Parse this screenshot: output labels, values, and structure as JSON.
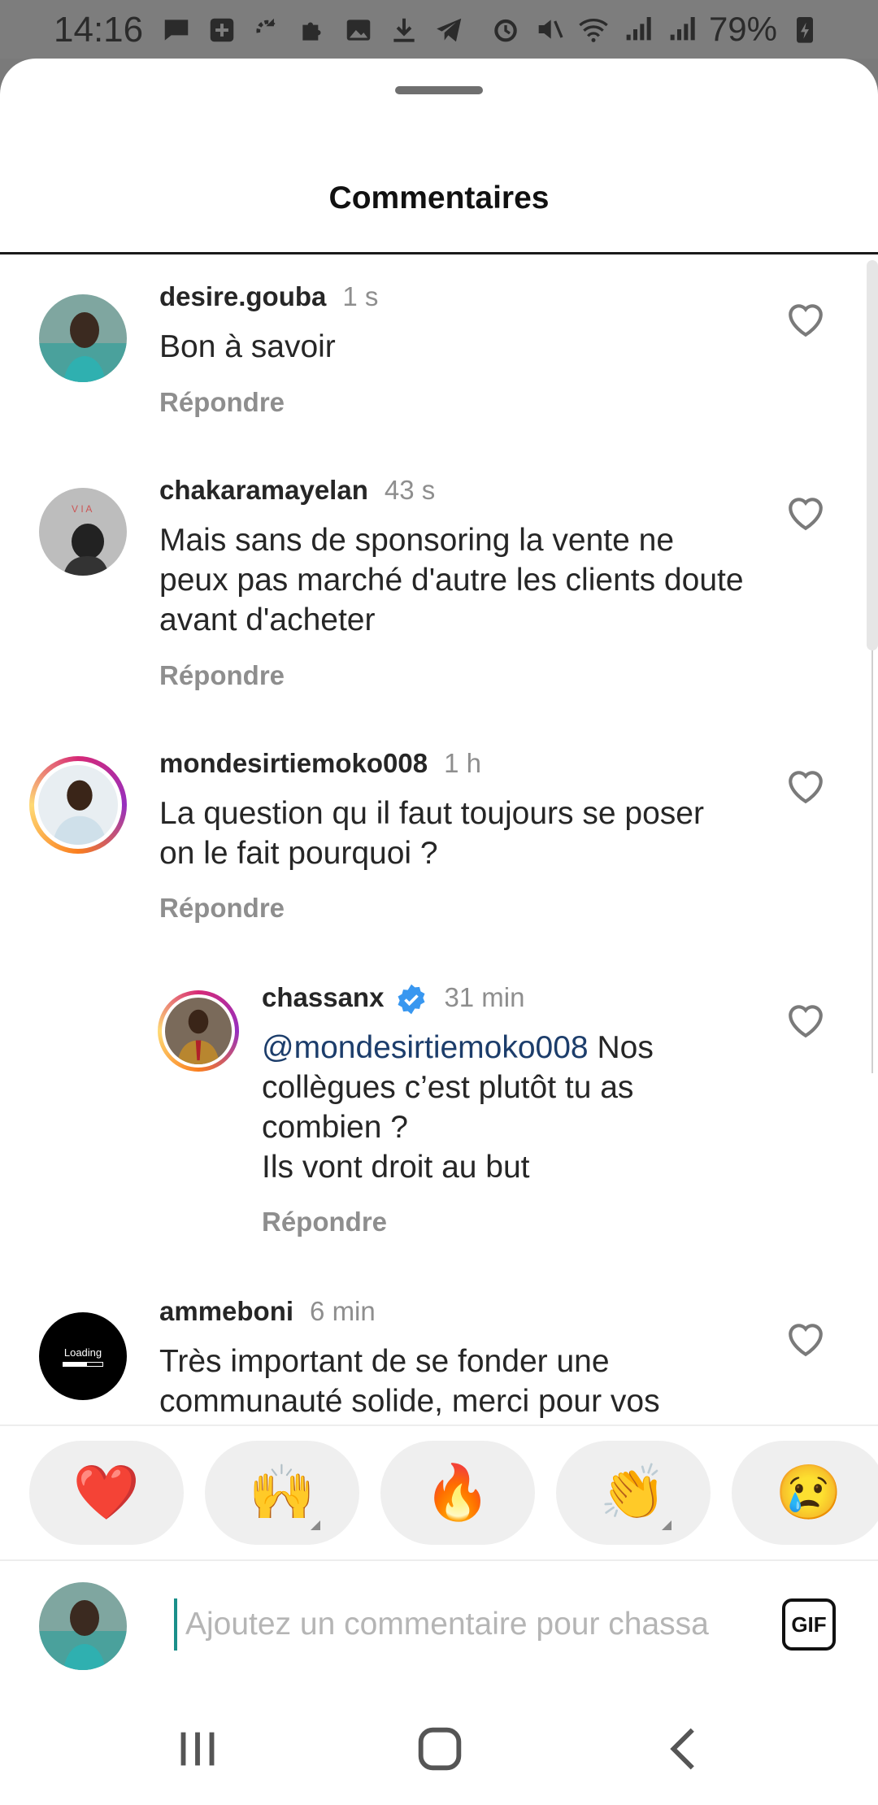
{
  "status_bar": {
    "time": "14:16",
    "battery": "79%",
    "left_icons": [
      "message-icon",
      "plus-square-icon",
      "sync-icon",
      "puzzle-icon",
      "image-icon",
      "download-icon",
      "telegram-icon"
    ],
    "right_icons": [
      "alarm-icon",
      "mute-icon",
      "wifi-icon",
      "signal-icon",
      "signal-icon",
      "battery-charging-icon"
    ]
  },
  "sheet": {
    "title": "Commentaires"
  },
  "comments": [
    {
      "username": "desire.gouba",
      "time": "1 s",
      "text": "Bon à savoir",
      "reply_label": "Répondre"
    },
    {
      "username": "chakaramayelan",
      "time": "43 s",
      "text": "Mais sans de sponsoring la vente ne peux pas marché d'autre les clients doute avant d'acheter",
      "reply_label": "Répondre"
    },
    {
      "username": "mondesirtiemoko008",
      "time": "1 h",
      "text": "La question qu il faut toujours se poser on le fait pourquoi ?",
      "reply_label": "Répondre"
    },
    {
      "username": "chassanx",
      "verified": true,
      "time": "31 min",
      "mention": "@mondesirtiemoko008",
      "text": " Nos collègues c’est plutôt tu as combien ?",
      "text_line2": "Ils vont droit au but",
      "reply_label": "Répondre"
    },
    {
      "username": "ammeboni",
      "time": "6 min",
      "avatar_text": "Loading",
      "text": "Très important de se fonder une communauté solide, merci pour vos"
    }
  ],
  "reactions": [
    "❤️",
    "🙌",
    "🔥",
    "👏",
    "😢"
  ],
  "composer": {
    "placeholder": "Ajoutez un commentaire pour chassa",
    "gif_label": "GIF"
  },
  "colors": {
    "accent_ring": "#d62976",
    "verified": "#3897f0",
    "text": "#262626",
    "muted": "#8e8e8e"
  }
}
